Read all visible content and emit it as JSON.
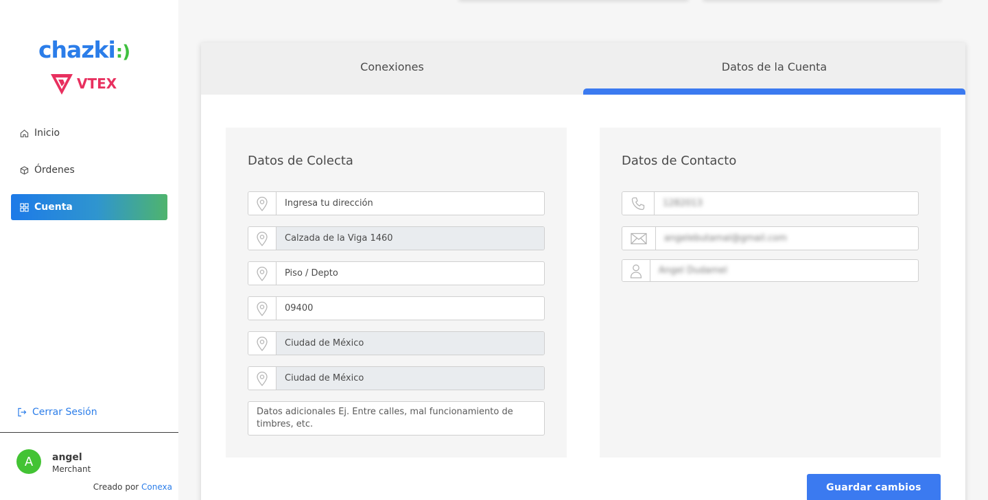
{
  "brand": {
    "logo_primary": "chazki",
    "logo_primary_suffix": ":)",
    "logo_partner": "VTEX",
    "primary_color": "#2b7de9",
    "partner_color": "#e8305f"
  },
  "sidebar": {
    "items": [
      {
        "label": "Inicio",
        "icon": "home-icon"
      },
      {
        "label": "Órdenes",
        "icon": "box-icon"
      },
      {
        "label": "Cuenta",
        "icon": "grid-icon",
        "active": true
      }
    ],
    "logout_label": "Cerrar Sesión",
    "user": {
      "initial": "A",
      "name": "angel",
      "role": "Merchant"
    },
    "credit_prefix": "Creado por",
    "credit_brand": "Conexa"
  },
  "tabs": [
    {
      "label": "Conexiones",
      "active": false
    },
    {
      "label": "Datos de la Cuenta",
      "active": true
    }
  ],
  "collect": {
    "title": "Datos de Colecta",
    "fields": [
      {
        "value": "Ingresa tu dirección",
        "disabled": false
      },
      {
        "value": "Calzada de la Viga 1460",
        "disabled": true
      },
      {
        "value": "Piso / Depto",
        "disabled": false
      },
      {
        "value": "09400",
        "disabled": false
      },
      {
        "value": "Ciudad de México",
        "disabled": true
      },
      {
        "value": "Ciudad de México",
        "disabled": true
      }
    ],
    "notes_placeholder": "Datos adicionales Ej. Entre calles, mal funcionamiento de timbres, etc."
  },
  "contact": {
    "title": "Datos de Contacto",
    "phone": "1282013",
    "email": "angelebutamal@gmail.com",
    "name": "Angel Dudamel"
  },
  "actions": {
    "save_label": "Guardar cambios"
  },
  "colors": {
    "accent": "#3b7af0",
    "avatar": "#43c334",
    "active_gradient_start": "#1d7ae8",
    "active_gradient_end": "#4fb46d"
  }
}
